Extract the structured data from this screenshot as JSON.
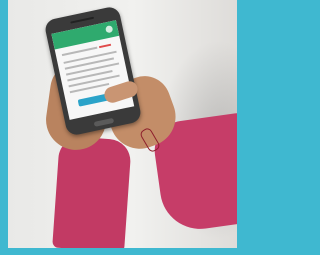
{
  "scene": {
    "background_color": "#3fb8d0",
    "phone_color": "#3a3a3a",
    "app_bar_color": "#2faa6e",
    "sleeve_color": "#c63d68",
    "button_color": "#2ba3c9"
  }
}
